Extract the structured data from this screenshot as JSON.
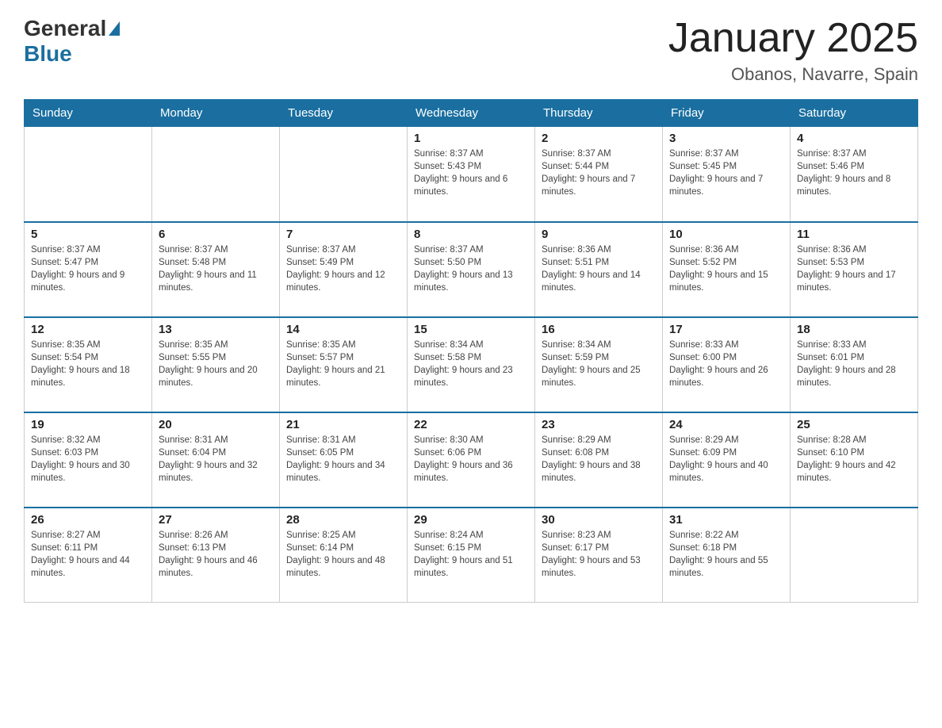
{
  "header": {
    "logo_general": "General",
    "logo_blue": "Blue",
    "title": "January 2025",
    "subtitle": "Obanos, Navarre, Spain"
  },
  "days_of_week": [
    "Sunday",
    "Monday",
    "Tuesday",
    "Wednesday",
    "Thursday",
    "Friday",
    "Saturday"
  ],
  "weeks": [
    [
      {
        "day": "",
        "info": ""
      },
      {
        "day": "",
        "info": ""
      },
      {
        "day": "",
        "info": ""
      },
      {
        "day": "1",
        "info": "Sunrise: 8:37 AM\nSunset: 5:43 PM\nDaylight: 9 hours and 6 minutes."
      },
      {
        "day": "2",
        "info": "Sunrise: 8:37 AM\nSunset: 5:44 PM\nDaylight: 9 hours and 7 minutes."
      },
      {
        "day": "3",
        "info": "Sunrise: 8:37 AM\nSunset: 5:45 PM\nDaylight: 9 hours and 7 minutes."
      },
      {
        "day": "4",
        "info": "Sunrise: 8:37 AM\nSunset: 5:46 PM\nDaylight: 9 hours and 8 minutes."
      }
    ],
    [
      {
        "day": "5",
        "info": "Sunrise: 8:37 AM\nSunset: 5:47 PM\nDaylight: 9 hours and 9 minutes."
      },
      {
        "day": "6",
        "info": "Sunrise: 8:37 AM\nSunset: 5:48 PM\nDaylight: 9 hours and 11 minutes."
      },
      {
        "day": "7",
        "info": "Sunrise: 8:37 AM\nSunset: 5:49 PM\nDaylight: 9 hours and 12 minutes."
      },
      {
        "day": "8",
        "info": "Sunrise: 8:37 AM\nSunset: 5:50 PM\nDaylight: 9 hours and 13 minutes."
      },
      {
        "day": "9",
        "info": "Sunrise: 8:36 AM\nSunset: 5:51 PM\nDaylight: 9 hours and 14 minutes."
      },
      {
        "day": "10",
        "info": "Sunrise: 8:36 AM\nSunset: 5:52 PM\nDaylight: 9 hours and 15 minutes."
      },
      {
        "day": "11",
        "info": "Sunrise: 8:36 AM\nSunset: 5:53 PM\nDaylight: 9 hours and 17 minutes."
      }
    ],
    [
      {
        "day": "12",
        "info": "Sunrise: 8:35 AM\nSunset: 5:54 PM\nDaylight: 9 hours and 18 minutes."
      },
      {
        "day": "13",
        "info": "Sunrise: 8:35 AM\nSunset: 5:55 PM\nDaylight: 9 hours and 20 minutes."
      },
      {
        "day": "14",
        "info": "Sunrise: 8:35 AM\nSunset: 5:57 PM\nDaylight: 9 hours and 21 minutes."
      },
      {
        "day": "15",
        "info": "Sunrise: 8:34 AM\nSunset: 5:58 PM\nDaylight: 9 hours and 23 minutes."
      },
      {
        "day": "16",
        "info": "Sunrise: 8:34 AM\nSunset: 5:59 PM\nDaylight: 9 hours and 25 minutes."
      },
      {
        "day": "17",
        "info": "Sunrise: 8:33 AM\nSunset: 6:00 PM\nDaylight: 9 hours and 26 minutes."
      },
      {
        "day": "18",
        "info": "Sunrise: 8:33 AM\nSunset: 6:01 PM\nDaylight: 9 hours and 28 minutes."
      }
    ],
    [
      {
        "day": "19",
        "info": "Sunrise: 8:32 AM\nSunset: 6:03 PM\nDaylight: 9 hours and 30 minutes."
      },
      {
        "day": "20",
        "info": "Sunrise: 8:31 AM\nSunset: 6:04 PM\nDaylight: 9 hours and 32 minutes."
      },
      {
        "day": "21",
        "info": "Sunrise: 8:31 AM\nSunset: 6:05 PM\nDaylight: 9 hours and 34 minutes."
      },
      {
        "day": "22",
        "info": "Sunrise: 8:30 AM\nSunset: 6:06 PM\nDaylight: 9 hours and 36 minutes."
      },
      {
        "day": "23",
        "info": "Sunrise: 8:29 AM\nSunset: 6:08 PM\nDaylight: 9 hours and 38 minutes."
      },
      {
        "day": "24",
        "info": "Sunrise: 8:29 AM\nSunset: 6:09 PM\nDaylight: 9 hours and 40 minutes."
      },
      {
        "day": "25",
        "info": "Sunrise: 8:28 AM\nSunset: 6:10 PM\nDaylight: 9 hours and 42 minutes."
      }
    ],
    [
      {
        "day": "26",
        "info": "Sunrise: 8:27 AM\nSunset: 6:11 PM\nDaylight: 9 hours and 44 minutes."
      },
      {
        "day": "27",
        "info": "Sunrise: 8:26 AM\nSunset: 6:13 PM\nDaylight: 9 hours and 46 minutes."
      },
      {
        "day": "28",
        "info": "Sunrise: 8:25 AM\nSunset: 6:14 PM\nDaylight: 9 hours and 48 minutes."
      },
      {
        "day": "29",
        "info": "Sunrise: 8:24 AM\nSunset: 6:15 PM\nDaylight: 9 hours and 51 minutes."
      },
      {
        "day": "30",
        "info": "Sunrise: 8:23 AM\nSunset: 6:17 PM\nDaylight: 9 hours and 53 minutes."
      },
      {
        "day": "31",
        "info": "Sunrise: 8:22 AM\nSunset: 6:18 PM\nDaylight: 9 hours and 55 minutes."
      },
      {
        "day": "",
        "info": ""
      }
    ]
  ]
}
